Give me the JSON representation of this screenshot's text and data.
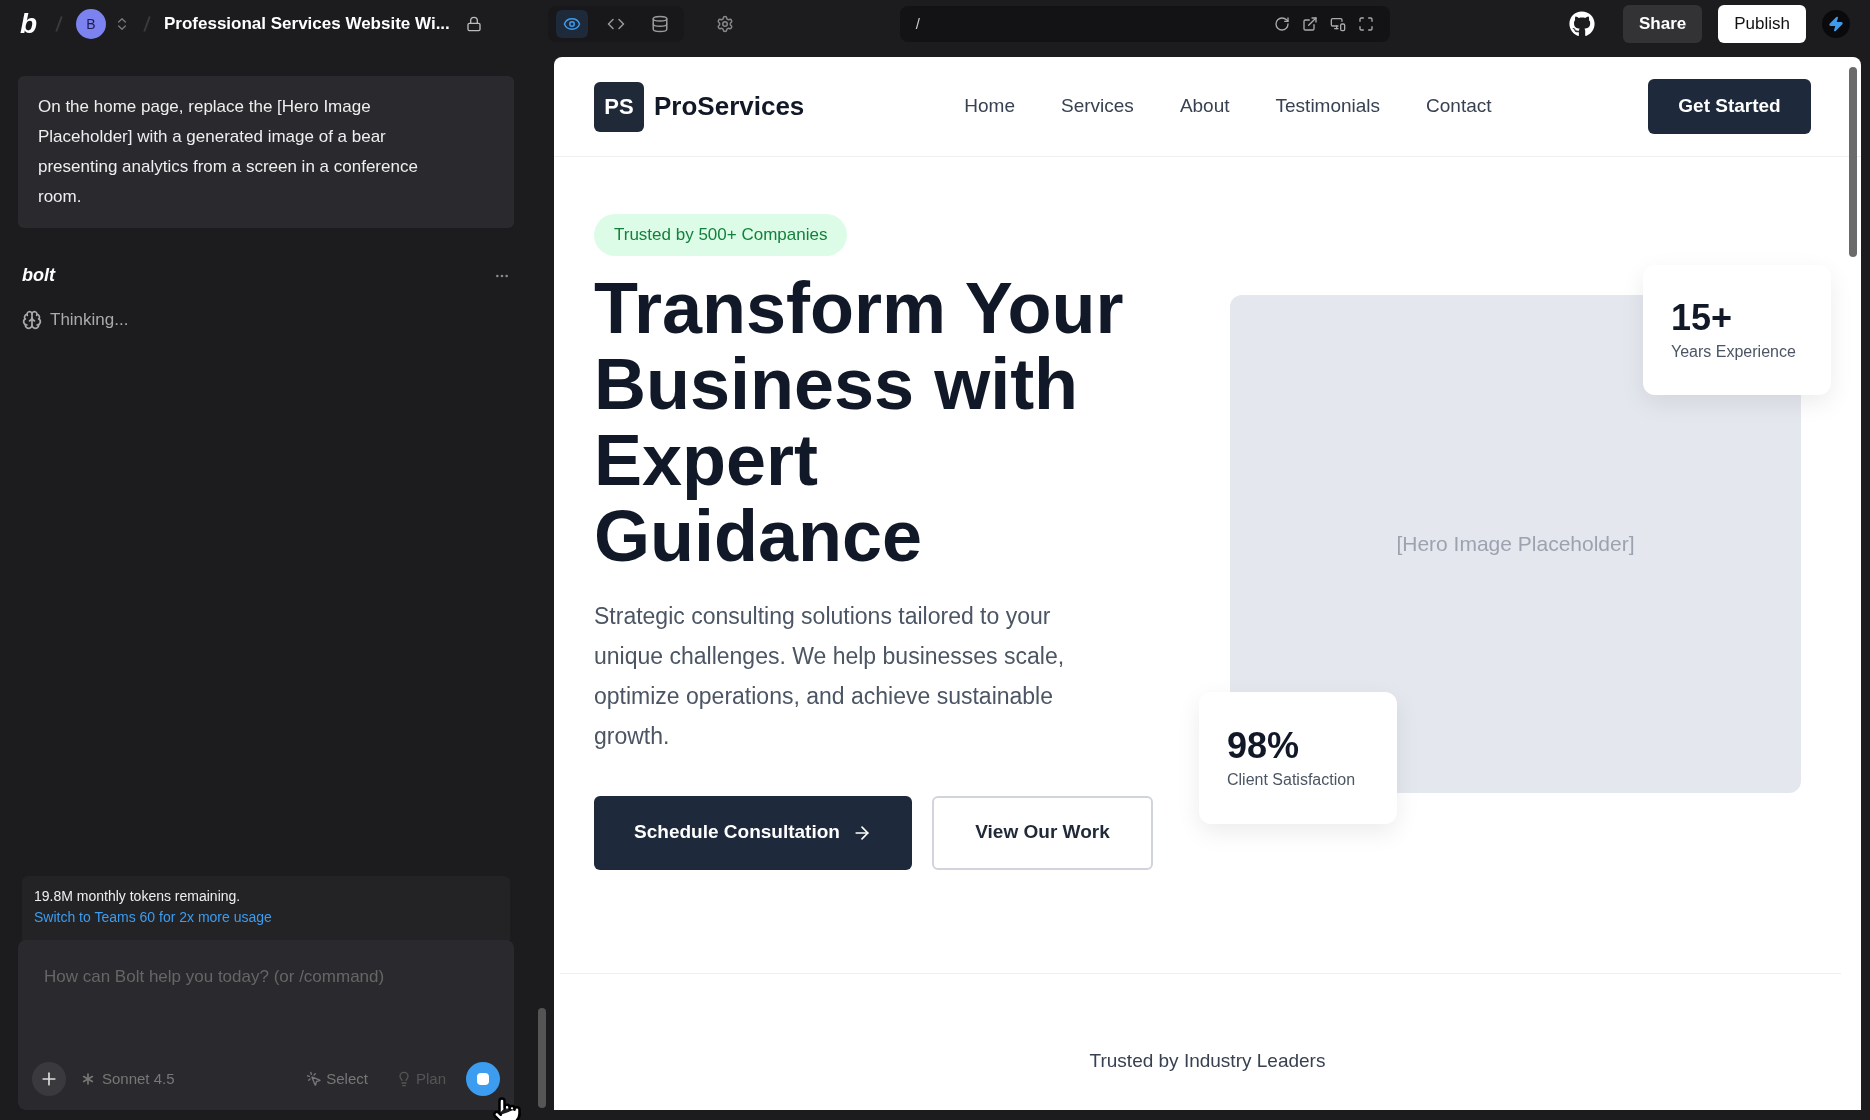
{
  "topbar": {
    "logo": "b",
    "avatar": "B",
    "project_title": "Professional Services Website Wi...",
    "view_tabs": [
      {
        "kind": "preview",
        "selected": true
      },
      {
        "kind": "code",
        "selected": false
      },
      {
        "kind": "database",
        "selected": false
      }
    ],
    "url": "/",
    "share": "Share",
    "publish": "Publish"
  },
  "chat": {
    "user_message": "On the home page, replace the [Hero Image Placeholder] with a generated image of a bear presenting analytics from a screen in a conference room.",
    "assistant_name": "bolt",
    "status": "Thinking...",
    "tokens_text": "19.8M monthly tokens remaining.",
    "tokens_link": "Switch to Teams 60 for 2x more usage",
    "input": {
      "placeholder": "How can Bolt help you today? (or /command)"
    },
    "model": "Sonnet 4.5",
    "select": "Select",
    "plan": "Plan"
  },
  "preview": {
    "logo_mark": "PS",
    "brand": "ProServices",
    "nav": [
      "Home",
      "Services",
      "About",
      "Testimonials",
      "Contact"
    ],
    "cta": "Get Started",
    "badge": "Trusted by 500+ Companies",
    "headline": "Transform Your Business with Expert Guidance",
    "description": "Strategic consulting solutions tailored to your unique challenges. We help businesses scale, optimize operations, and achieve sustainable growth.",
    "buttons": [
      {
        "label": "Schedule Consultation",
        "kind": "primary"
      },
      {
        "label": "View Our Work",
        "kind": "secondary"
      }
    ],
    "image_placeholder": "[Hero Image Placeholder]",
    "stats": [
      {
        "value": "15+",
        "label": "Years Experience"
      },
      {
        "value": "98%",
        "label": "Client Satisfaction"
      }
    ],
    "trusted_heading": "Trusted by Industry Leaders"
  }
}
